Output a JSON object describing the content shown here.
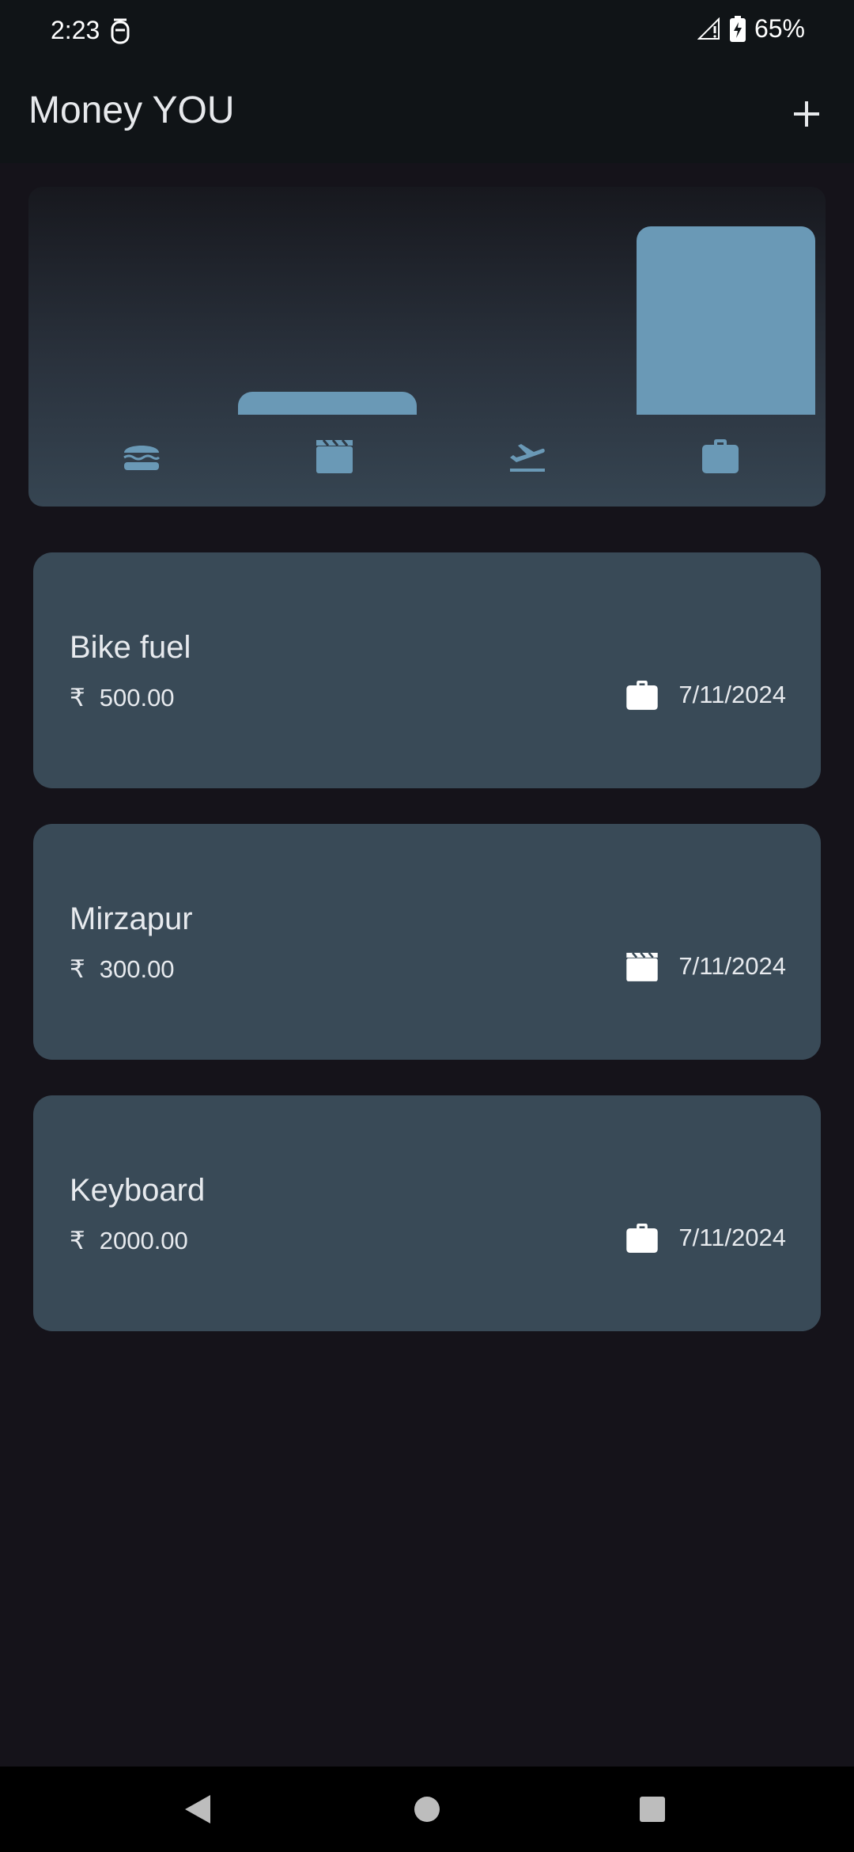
{
  "status_bar": {
    "time": "2:23",
    "battery": "65%"
  },
  "app_bar": {
    "title": "Money YOU",
    "add_icon": "plus-icon"
  },
  "chart_data": {
    "type": "bar",
    "categories": [
      "food",
      "leisure",
      "travel",
      "work"
    ],
    "values": [
      0,
      300,
      0,
      2500
    ],
    "ylim": [
      0,
      2500
    ],
    "category_icons": [
      "hamburger-icon",
      "movie-clapper-icon",
      "flight-takeoff-icon",
      "briefcase-icon"
    ],
    "bar_color": "#6a99b6"
  },
  "expenses": [
    {
      "title": "Bike fuel",
      "currency": "₹",
      "amount": "500.00",
      "date": "7/11/2024",
      "category_icon": "briefcase-icon"
    },
    {
      "title": "Mirzapur",
      "currency": "₹",
      "amount": "300.00",
      "date": "7/11/2024",
      "category_icon": "movie-clapper-icon"
    },
    {
      "title": "Keyboard",
      "currency": "₹",
      "amount": "2000.00",
      "date": "7/11/2024",
      "category_icon": "briefcase-icon"
    }
  ],
  "colors": {
    "background": "#15131a",
    "card": "#394a57",
    "accent": "#6a99b6",
    "appbar": "#101417"
  }
}
